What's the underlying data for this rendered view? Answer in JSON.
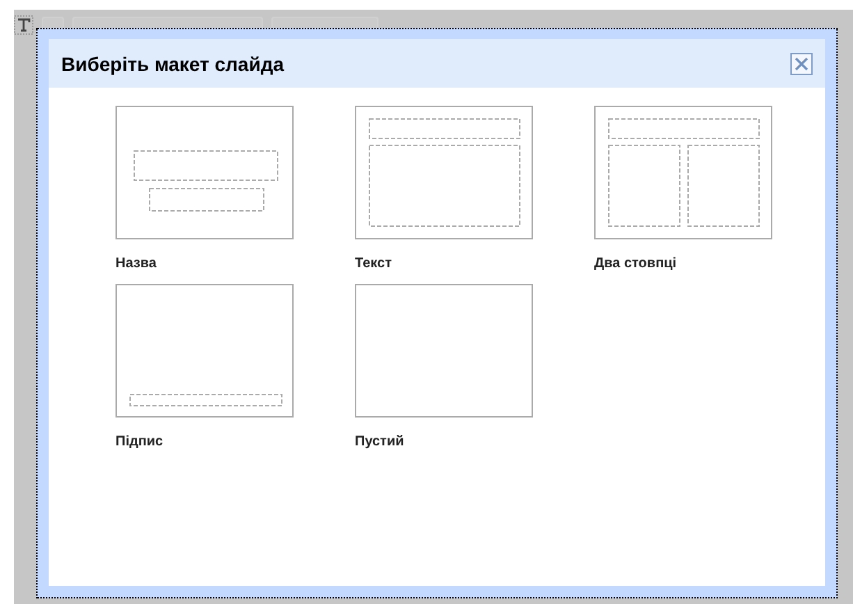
{
  "dialog": {
    "title": "Виберіть макет слайда",
    "layouts": [
      {
        "kind": "title",
        "label": "Назва"
      },
      {
        "kind": "text",
        "label": "Текст"
      },
      {
        "kind": "two-columns",
        "label": "Два стовпці"
      },
      {
        "kind": "caption",
        "label": "Підпис"
      },
      {
        "kind": "blank",
        "label": "Пустий"
      }
    ]
  }
}
